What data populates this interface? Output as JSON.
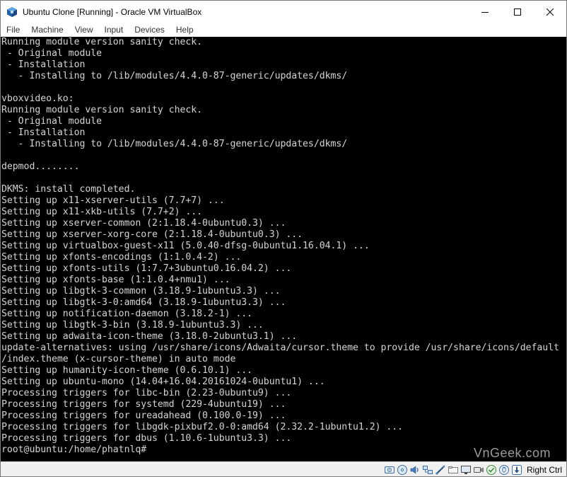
{
  "window": {
    "title": "Ubuntu Clone [Running] - Oracle VM VirtualBox"
  },
  "menubar": {
    "items": [
      "File",
      "Machine",
      "View",
      "Input",
      "Devices",
      "Help"
    ]
  },
  "terminal": {
    "lines": [
      "Running module version sanity check.",
      " - Original module",
      " - Installation",
      "   - Installing to /lib/modules/4.4.0-87-generic/updates/dkms/",
      "",
      "vboxvideo.ko:",
      "Running module version sanity check.",
      " - Original module",
      " - Installation",
      "   - Installing to /lib/modules/4.4.0-87-generic/updates/dkms/",
      "",
      "depmod........",
      "",
      "DKMS: install completed.",
      "Setting up x11-xserver-utils (7.7+7) ...",
      "Setting up x11-xkb-utils (7.7+2) ...",
      "Setting up xserver-common (2:1.18.4-0ubuntu0.3) ...",
      "Setting up xserver-xorg-core (2:1.18.4-0ubuntu0.3) ...",
      "Setting up virtualbox-guest-x11 (5.0.40-dfsg-0ubuntu1.16.04.1) ...",
      "Setting up xfonts-encodings (1:1.0.4-2) ...",
      "Setting up xfonts-utils (1:7.7+3ubuntu0.16.04.2) ...",
      "Setting up xfonts-base (1:1.0.4+nmu1) ...",
      "Setting up libgtk-3-common (3.18.9-1ubuntu3.3) ...",
      "Setting up libgtk-3-0:amd64 (3.18.9-1ubuntu3.3) ...",
      "Setting up notification-daemon (3.18.2-1) ...",
      "Setting up libgtk-3-bin (3.18.9-1ubuntu3.3) ...",
      "Setting up adwaita-icon-theme (3.18.0-2ubuntu3.1) ...",
      "update-alternatives: using /usr/share/icons/Adwaita/cursor.theme to provide /usr/share/icons/default",
      "/index.theme (x-cursor-theme) in auto mode",
      "Setting up humanity-icon-theme (0.6.10.1) ...",
      "Setting up ubuntu-mono (14.04+16.04.20161024-0ubuntu1) ...",
      "Processing triggers for libc-bin (2.23-0ubuntu9) ...",
      "Processing triggers for systemd (229-4ubuntu19) ...",
      "Processing triggers for ureadahead (0.100.0-19) ...",
      "Processing triggers for libgdk-pixbuf2.0-0:amd64 (2.32.2-1ubuntu1.2) ...",
      "Processing triggers for dbus (1.10.6-1ubuntu3.3) ...",
      "root@ubuntu:/home/phatnlq#"
    ],
    "watermark": "VnGeek.com",
    "colors": {
      "background": "#000000",
      "text": "#d4d4d4"
    }
  },
  "statusbar": {
    "icons": [
      "hard-disk-icon",
      "optical-drive-icon",
      "audio-icon",
      "network-icon",
      "usb-icon",
      "shared-folders-icon",
      "display-icon",
      "video-capture-icon",
      "virtualization-icon",
      "mouse-integration-icon",
      "host-key-arrow-icon"
    ],
    "host_key": "Right Ctrl"
  }
}
